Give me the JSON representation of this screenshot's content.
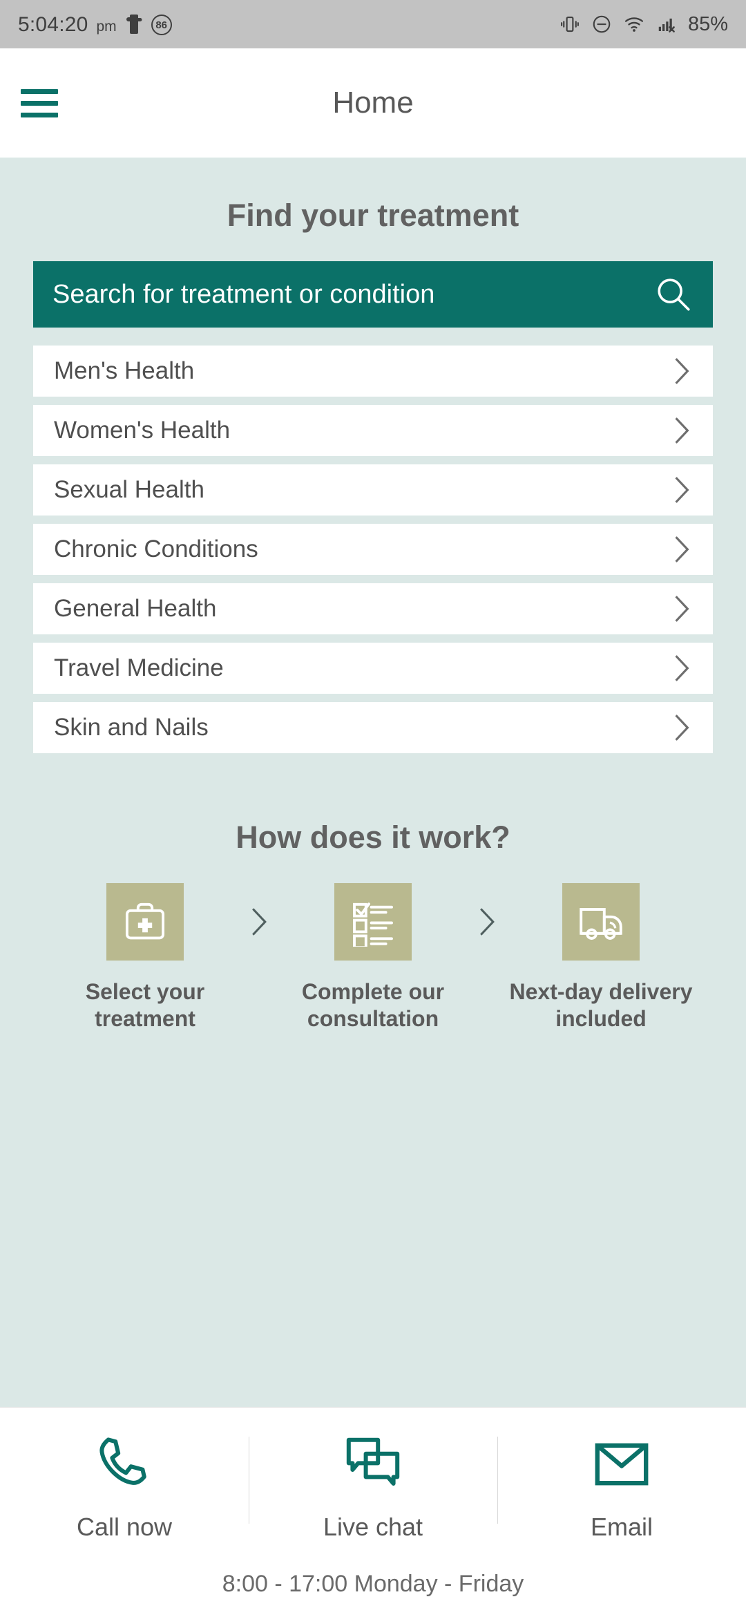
{
  "statusbar": {
    "time": "5:04:20",
    "ampm": "pm",
    "notification_badge": "86",
    "battery": "85%",
    "icons": [
      "puzzle-icon",
      "badge-86-icon",
      "vibrate-icon",
      "do-not-disturb-icon",
      "wifi-icon",
      "signal-off-icon"
    ]
  },
  "appbar": {
    "title": "Home",
    "menu_icon": "hamburger-menu-icon"
  },
  "find": {
    "heading": "Find your treatment",
    "search_placeholder": "Search for treatment or condition",
    "search_value": "",
    "search_icon": "search-icon"
  },
  "categories": [
    {
      "label": "Men's Health"
    },
    {
      "label": "Women's Health"
    },
    {
      "label": "Sexual Health"
    },
    {
      "label": "Chronic Conditions"
    },
    {
      "label": "General Health"
    },
    {
      "label": "Travel Medicine"
    },
    {
      "label": "Skin and Nails"
    }
  ],
  "how_it_works": {
    "heading": "How does it work?",
    "steps": [
      {
        "label": "Select your treatment",
        "icon": "medical-bag-icon"
      },
      {
        "label": "Complete our consultation",
        "icon": "checklist-icon"
      },
      {
        "label": "Next-day delivery included",
        "icon": "delivery-truck-icon"
      }
    ]
  },
  "footer": {
    "contacts": [
      {
        "label": "Call now",
        "icon": "phone-icon"
      },
      {
        "label": "Live chat",
        "icon": "chat-bubbles-icon"
      },
      {
        "label": "Email",
        "icon": "envelope-icon"
      }
    ],
    "hours": "8:00 - 17:00 Monday - Friday"
  },
  "colors": {
    "brand_teal": "#0b7168",
    "panel_bg": "#dbe8e6",
    "tile_khaki": "#b9b98f",
    "statusbar_bg": "#c2c2c2"
  }
}
